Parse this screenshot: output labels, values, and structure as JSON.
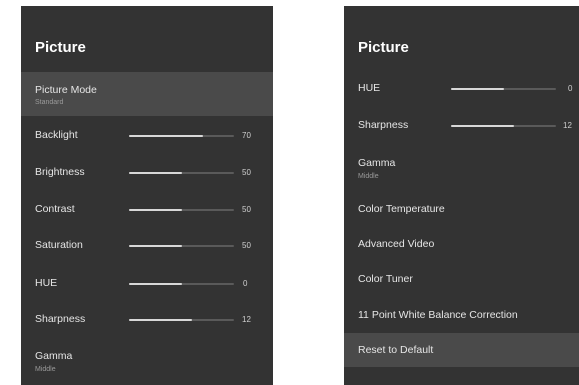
{
  "left_panel": {
    "title": "Picture",
    "items": [
      {
        "label": "Picture Mode",
        "sub": "Standard",
        "selected": true
      },
      {
        "label": "Backlight",
        "value": "70",
        "fraction": 0.7
      },
      {
        "label": "Brightness",
        "value": "50",
        "fraction": 0.5
      },
      {
        "label": "Contrast",
        "value": "50",
        "fraction": 0.5
      },
      {
        "label": "Saturation",
        "value": "50",
        "fraction": 0.5
      },
      {
        "label": "HUE",
        "value": "0",
        "fraction": 0.5
      },
      {
        "label": "Sharpness",
        "value": "12",
        "fraction": 0.6
      },
      {
        "label": "Gamma",
        "sub": "Middle"
      }
    ]
  },
  "right_panel": {
    "title": "Picture",
    "items": [
      {
        "label": "HUE",
        "value": "0",
        "fraction": 0.5
      },
      {
        "label": "Sharpness",
        "value": "12",
        "fraction": 0.6
      },
      {
        "label": "Gamma",
        "sub": "Middle"
      },
      {
        "label": "Color Temperature"
      },
      {
        "label": "Advanced Video"
      },
      {
        "label": "Color Tuner"
      },
      {
        "label": "11 Point White Balance Correction"
      },
      {
        "label": "Reset to Default",
        "selected": true
      }
    ]
  },
  "colors": {
    "panel_bg": "#333333",
    "highlight_bg": "#4a4a4a",
    "slider_fill": "#d8d8d8",
    "slider_track": "#5a5a5a",
    "text": "#e6e6e6"
  }
}
